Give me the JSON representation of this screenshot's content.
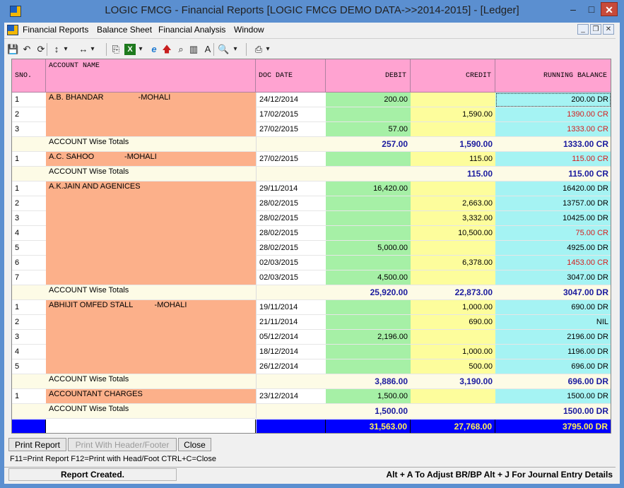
{
  "window": {
    "title": "LOGIC FMCG - Financial Reports  [LOGIC FMCG DEMO DATA->>2014-2015] - [Ledger]",
    "min_glyph": "–",
    "max_glyph": "□",
    "close_glyph": "✕"
  },
  "menu": {
    "items": [
      "Financial Reports",
      "Balance Sheet",
      "Financial Analysis",
      "Window"
    ],
    "child_min": "_",
    "child_restore": "❐",
    "child_close": "✕"
  },
  "toolbar": {
    "icons": [
      {
        "name": "save-icon",
        "glyph": "💾"
      },
      {
        "name": "undo-icon",
        "glyph": "↶"
      },
      {
        "name": "refresh-icon",
        "glyph": "⟳"
      },
      {
        "name": "sort-icon",
        "glyph": "↕"
      },
      {
        "name": "sort-dropdown-icon",
        "glyph": "▾"
      },
      {
        "name": "column-width-icon",
        "glyph": "↔"
      },
      {
        "name": "column-width-dropdown-icon",
        "glyph": "▾"
      },
      {
        "name": "copy-icon",
        "glyph": "⎘"
      },
      {
        "name": "excel-icon",
        "glyph": "X"
      },
      {
        "name": "excel-dropdown-icon",
        "glyph": "▾"
      },
      {
        "name": "web-icon",
        "glyph": "e"
      },
      {
        "name": "up-arrow-icon",
        "glyph": "🡅"
      },
      {
        "name": "find-icon",
        "glyph": "⌕"
      },
      {
        "name": "chart-icon",
        "glyph": "▥"
      },
      {
        "name": "font-icon",
        "glyph": "A"
      },
      {
        "name": "preview-icon",
        "glyph": "🔍"
      },
      {
        "name": "preview-dropdown-icon",
        "glyph": "▾"
      },
      {
        "name": "print-icon",
        "glyph": "⎙"
      },
      {
        "name": "print-dropdown-icon",
        "glyph": "▾"
      }
    ],
    "colors": {
      "excel": "#1e7a1e",
      "web": "#1f7ad1",
      "up_arrow": "#c81e1e"
    }
  },
  "grid": {
    "columns": {
      "sno": "SNO.",
      "account": "ACCOUNT NAME",
      "date": "DOC DATE",
      "debit": "DEBIT",
      "credit": "CREDIT",
      "balance": "RUNNING BALANCE"
    },
    "rows": [
      {
        "t": "d",
        "sno": "1",
        "acct": "A.B. BHANDAR                -MOHALI",
        "date": "24/12/2014",
        "deb": "200.00",
        "cre": "",
        "bal": "200.00 DR",
        "neg": false
      },
      {
        "t": "d",
        "sno": "2",
        "acct": "",
        "date": "17/02/2015",
        "deb": "",
        "cre": "1,590.00",
        "bal": "1390.00 CR",
        "neg": true
      },
      {
        "t": "d",
        "sno": "3",
        "acct": "",
        "date": "27/02/2015",
        "deb": "57.00",
        "cre": "",
        "bal": "1333.00 CR",
        "neg": true
      },
      {
        "t": "t",
        "sno": "",
        "acct": "ACCOUNT Wise Totals",
        "date": "",
        "deb": "257.00",
        "cre": "1,590.00",
        "bal": "1333.00 CR",
        "neg": false
      },
      {
        "t": "d",
        "sno": "1",
        "acct": "A.C. SAHOO              -MOHALI",
        "date": "27/02/2015",
        "deb": "",
        "cre": "115.00",
        "bal": "115.00 CR",
        "neg": true
      },
      {
        "t": "t",
        "sno": "",
        "acct": "ACCOUNT Wise Totals",
        "date": "",
        "deb": "",
        "cre": "115.00",
        "bal": "115.00 CR",
        "neg": false
      },
      {
        "t": "d",
        "sno": "1",
        "acct": "A.K.JAIN AND AGENICES",
        "date": "29/11/2014",
        "deb": "16,420.00",
        "cre": "",
        "bal": "16420.00 DR",
        "neg": false
      },
      {
        "t": "d",
        "sno": "2",
        "acct": "",
        "date": "28/02/2015",
        "deb": "",
        "cre": "2,663.00",
        "bal": "13757.00 DR",
        "neg": false
      },
      {
        "t": "d",
        "sno": "3",
        "acct": "",
        "date": "28/02/2015",
        "deb": "",
        "cre": "3,332.00",
        "bal": "10425.00 DR",
        "neg": false
      },
      {
        "t": "d",
        "sno": "4",
        "acct": "",
        "date": "28/02/2015",
        "deb": "",
        "cre": "10,500.00",
        "bal": "75.00 CR",
        "neg": true
      },
      {
        "t": "d",
        "sno": "5",
        "acct": "",
        "date": "28/02/2015",
        "deb": "5,000.00",
        "cre": "",
        "bal": "4925.00 DR",
        "neg": false
      },
      {
        "t": "d",
        "sno": "6",
        "acct": "",
        "date": "02/03/2015",
        "deb": "",
        "cre": "6,378.00",
        "bal": "1453.00 CR",
        "neg": true
      },
      {
        "t": "d",
        "sno": "7",
        "acct": "",
        "date": "02/03/2015",
        "deb": "4,500.00",
        "cre": "",
        "bal": "3047.00 DR",
        "neg": false
      },
      {
        "t": "t",
        "sno": "",
        "acct": "ACCOUNT Wise Totals",
        "date": "",
        "deb": "25,920.00",
        "cre": "22,873.00",
        "bal": "3047.00 DR",
        "neg": false
      },
      {
        "t": "d",
        "sno": "1",
        "acct": "ABHIJIT OMFED STALL          -MOHALI",
        "date": "19/11/2014",
        "deb": "",
        "cre": "1,000.00",
        "bal": "690.00 DR",
        "neg": false
      },
      {
        "t": "d",
        "sno": "2",
        "acct": "",
        "date": "21/11/2014",
        "deb": "",
        "cre": "690.00",
        "bal": "NIL",
        "neg": false
      },
      {
        "t": "d",
        "sno": "3",
        "acct": "",
        "date": "05/12/2014",
        "deb": "2,196.00",
        "cre": "",
        "bal": "2196.00 DR",
        "neg": false
      },
      {
        "t": "d",
        "sno": "4",
        "acct": "",
        "date": "18/12/2014",
        "deb": "",
        "cre": "1,000.00",
        "bal": "1196.00 DR",
        "neg": false
      },
      {
        "t": "d",
        "sno": "5",
        "acct": "",
        "date": "26/12/2014",
        "deb": "",
        "cre": "500.00",
        "bal": "696.00 DR",
        "neg": false
      },
      {
        "t": "t",
        "sno": "",
        "acct": "ACCOUNT Wise Totals",
        "date": "",
        "deb": "3,886.00",
        "cre": "3,190.00",
        "bal": "696.00 DR",
        "neg": false
      },
      {
        "t": "d",
        "sno": "1",
        "acct": "ACCOUNTANT CHARGES",
        "date": "23/12/2014",
        "deb": "1,500.00",
        "cre": "",
        "bal": "1500.00 DR",
        "neg": false
      },
      {
        "t": "t",
        "sno": "",
        "acct": "ACCOUNT Wise Totals",
        "date": "",
        "deb": "1,500.00",
        "cre": "",
        "bal": "1500.00 DR",
        "neg": false
      },
      {
        "t": "g",
        "sno": "",
        "acct": "",
        "date": "",
        "deb": "31,563.00",
        "cre": "27,768.00",
        "bal": "3795.00 DR",
        "neg": false
      }
    ],
    "account_blocks": [
      {
        "start": 0,
        "len": 3
      },
      {
        "start": 4,
        "len": 1
      },
      {
        "start": 6,
        "len": 7
      },
      {
        "start": 14,
        "len": 5
      },
      {
        "start": 20,
        "len": 1
      }
    ],
    "colors": {
      "negative": "#d42020",
      "total_text": "#1a1a9e",
      "grand_bg": "#0000ff",
      "grand_text": "#ffef5a"
    }
  },
  "buttons": {
    "print_report": "Print Report",
    "print_header_footer": "Print With Header/Footer",
    "close": "Close"
  },
  "hint": "F11=Print Report  F12=Print with Head/Foot  CTRL+C=Close",
  "status": {
    "left": "Report Created.",
    "right": "Alt + A To Adjust BR/BP    Alt + J For Journal Entry Details"
  }
}
